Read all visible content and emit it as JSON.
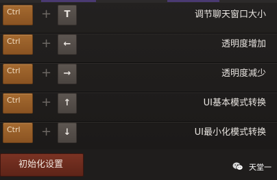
{
  "shortcuts": [
    {
      "modifier": "Ctrl",
      "plus": "+",
      "key_symbol": "T",
      "key_icon": "t-key",
      "description": "调节聊天窗口大小"
    },
    {
      "modifier": "Ctrl",
      "plus": "+",
      "key_symbol": "←",
      "key_icon": "arrow-left-icon",
      "description": "透明度增加"
    },
    {
      "modifier": "Ctrl",
      "plus": "+",
      "key_symbol": "→",
      "key_icon": "arrow-right-icon",
      "description": "透明度减少"
    },
    {
      "modifier": "Ctrl",
      "plus": "+",
      "key_symbol": "↑",
      "key_icon": "arrow-up-icon",
      "description": "UI基本模式转换"
    },
    {
      "modifier": "Ctrl",
      "plus": "+",
      "key_symbol": "↓",
      "key_icon": "arrow-down-icon",
      "description": "UI最小化模式转换"
    }
  ],
  "footer": {
    "reset_label": "初始化设置",
    "brand_text": "天堂一",
    "brand_icon": "wechat-icon"
  },
  "colors": {
    "ctrl_key": "#a46a30",
    "symbol_key": "#5d5651",
    "reset_button": "#7a3323",
    "accent_bar": "#4a3a72"
  }
}
